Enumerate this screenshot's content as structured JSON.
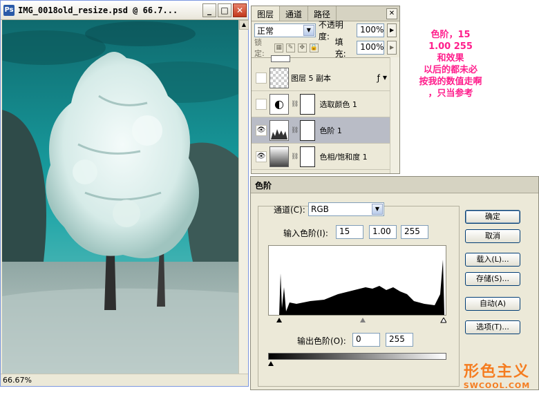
{
  "image_window": {
    "title": "IMG_0018old_resize.psd @ 66.7...",
    "zoom": "66.67%"
  },
  "layers_panel": {
    "tabs": [
      "图层",
      "通道",
      "路径"
    ],
    "blend_mode": "正常",
    "opacity_label": "不透明度:",
    "opacity_value": "100%",
    "lock_label": "锁定:",
    "fill_label": "填充:",
    "fill_value": "100%",
    "layers": [
      {
        "name": "图层 5 副本",
        "visible": false,
        "selected": false
      },
      {
        "name": "选取颜色 1",
        "visible": false,
        "selected": false
      },
      {
        "name": "色阶 1",
        "visible": true,
        "selected": true
      },
      {
        "name": "色相/饱和度 1",
        "visible": true,
        "selected": false
      }
    ]
  },
  "levels_dialog": {
    "title": "色阶",
    "channel_label": "通道(C):",
    "channel_value": "RGB",
    "input_label": "输入色阶(I):",
    "input_black": "15",
    "input_gamma": "1.00",
    "input_white": "255",
    "output_label": "输出色阶(O):",
    "output_black": "0",
    "output_white": "255",
    "buttons": [
      "确定",
      "取消",
      "载入(L)...",
      "存储(S)...",
      "自动(A)",
      "选项(T)..."
    ]
  },
  "annotation": {
    "lines": [
      "色阶，15",
      "1.00  255",
      "和效果",
      "以后的都未必",
      "按我的数值走啊",
      "，只当参考"
    ]
  },
  "logo": {
    "big": "形色主义",
    "small": "SWCOOL.COM"
  }
}
